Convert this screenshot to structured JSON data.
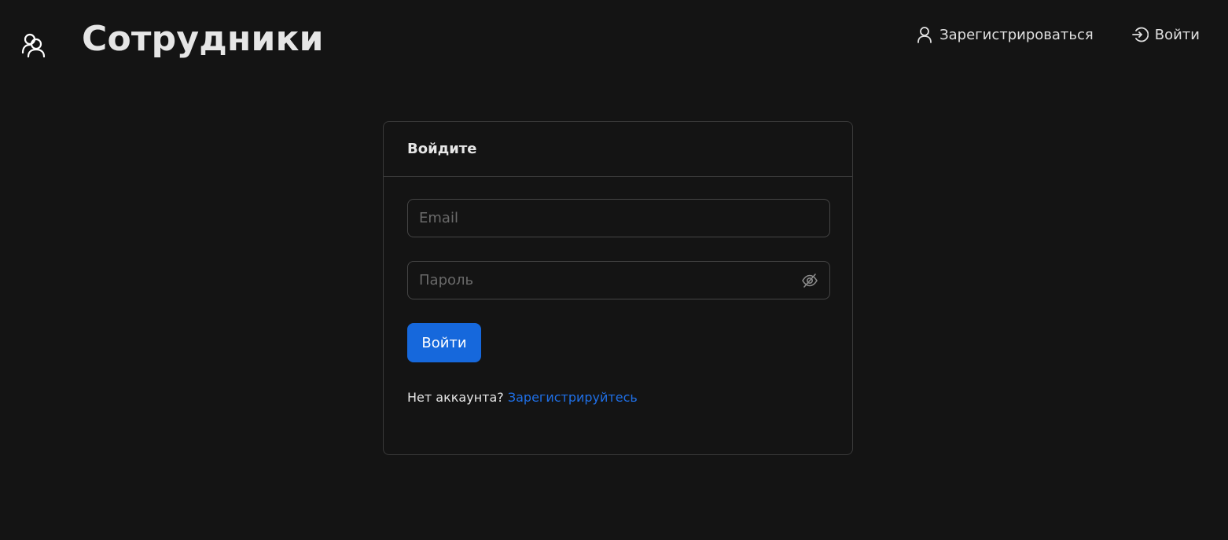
{
  "header": {
    "logo_icon": "team-icon",
    "title": "Сотрудники",
    "nav": {
      "register": {
        "label": "Зарегистрироваться",
        "icon": "user-icon"
      },
      "login": {
        "label": "Войти",
        "icon": "login-icon"
      }
    }
  },
  "login_card": {
    "title": "Войдите",
    "email": {
      "placeholder": "Email",
      "value": ""
    },
    "password": {
      "placeholder": "Пароль",
      "value": "",
      "toggle_icon": "eye-invisible-icon"
    },
    "submit_label": "Войти",
    "no_account_text": "Нет аккаунта?",
    "register_link": "Зарегистрируйтесь"
  },
  "colors": {
    "background": "#141414",
    "accent": "#1668dc",
    "link": "#1f6fe6",
    "border": "#3a3a3a"
  }
}
